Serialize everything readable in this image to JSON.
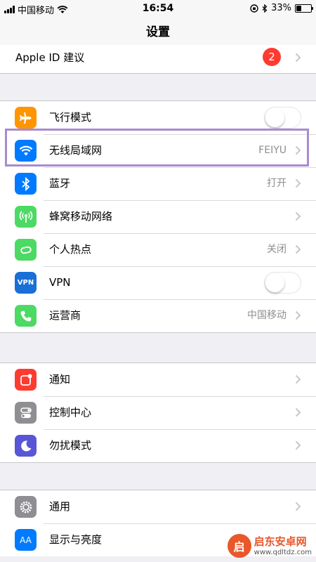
{
  "status_bar": {
    "carrier": "中国移动",
    "time": "16:54",
    "battery": "33%",
    "battery_level": 0.33
  },
  "nav": {
    "title": "设置"
  },
  "apple_id": {
    "label": "Apple ID 建议",
    "badge": "2"
  },
  "group1": [
    {
      "label": "飞行模式",
      "icon": "airplane-icon",
      "color": "#ff9500",
      "control": "toggle",
      "on": false
    },
    {
      "label": "无线局域网",
      "icon": "wifi-icon",
      "color": "#007aff",
      "value": "FEIYU"
    },
    {
      "label": "蓝牙",
      "icon": "bluetooth-icon",
      "color": "#007aff",
      "value": "打开"
    },
    {
      "label": "蜂窝移动网络",
      "icon": "antenna-icon",
      "color": "#4cd964"
    },
    {
      "label": "个人热点",
      "icon": "hotspot-icon",
      "color": "#4cd964",
      "value": "关闭"
    },
    {
      "label": "VPN",
      "icon": "vpn-icon",
      "icon_text": "VPN",
      "color": "#1a6fd6",
      "control": "toggle",
      "on": false
    },
    {
      "label": "运营商",
      "icon": "phone-icon",
      "color": "#4cd964",
      "value": "中国移动"
    }
  ],
  "group2": [
    {
      "label": "通知",
      "icon": "notification-icon",
      "color": "#ff3b30"
    },
    {
      "label": "控制中心",
      "icon": "control-center-icon",
      "color": "#8e8e93"
    },
    {
      "label": "勿扰模式",
      "icon": "moon-icon",
      "color": "#5856d6"
    }
  ],
  "group3": [
    {
      "label": "通用",
      "icon": "gear-icon",
      "color": "#8e8e93"
    },
    {
      "label": "显示与亮度",
      "icon": "display-icon",
      "icon_text": "AA",
      "color": "#007aff"
    }
  ],
  "watermark": {
    "logo_text": "启",
    "title": "启东安卓网",
    "url": "www.qdltdz.com"
  }
}
